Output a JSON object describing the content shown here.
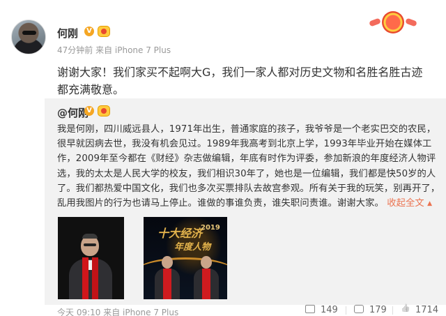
{
  "post": {
    "author": "何刚",
    "meta": "47分钟前 来自 iPhone 7 Plus",
    "status": "谢谢大家！我们家买不起啊大G，我们一家人都对历史文物和名胜名胜古迹都充满敬意。"
  },
  "repost": {
    "author": "@何刚",
    "body": "我是何刚，四川威远县人，1971年出生，普通家庭的孩子，我爷爷是一个老实巴交的农民，很早就因病去世，我没有机会见过。1989年我高考到北京上学，1993年毕业开始在媒体工作，2009年至今都在《财经》杂志做编辑，年底有时作为评委，参加新浪的年度经济人物评选，我的太太是人民大学的校友，我们相识30年了，她也是一位编辑，我们都是快50岁的人了。我们都热爱中国文化，我们也多次买票排队去故宫参观。所有关于我的玩笑，别再开了，乱用我图片的行为也请马上停止。谁做的事谁负责，谁失职问责谁。谢谢大家。",
    "collapse_label": "收起全文",
    "photo2_title_line1": "十大经济",
    "photo2_title_line2": "年度人物",
    "photo2_year": "2019"
  },
  "footer": {
    "meta": "今天 09:10 来自 iPhone 7 Plus",
    "repost_count": "149",
    "comment_count": "179",
    "like_count": "1714"
  },
  "colors": {
    "accent_link": "#eb7350",
    "verified_badge": "#f5a623"
  },
  "icons": [
    "verified-v-icon",
    "medal-icon",
    "rosette-icon",
    "repost-icon",
    "comment-icon",
    "like-icon"
  ]
}
